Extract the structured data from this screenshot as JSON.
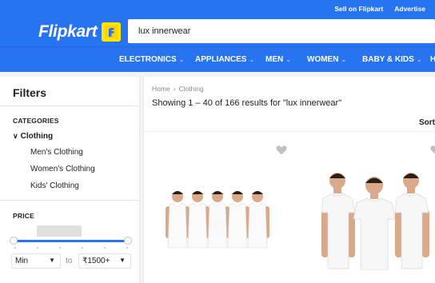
{
  "header": {
    "logo_text": "Flipkart",
    "top_links": [
      "Sell on Flipkart",
      "Advertise"
    ],
    "search": {
      "value": "lux innerwear"
    },
    "brand_color": "#2874f0",
    "badge_color": "#ffe500"
  },
  "nav": {
    "items": [
      "ELECTRONICS",
      "APPLIANCES",
      "MEN",
      "WOMEN",
      "BABY & KIDS",
      "H"
    ]
  },
  "sidebar": {
    "title": "Filters",
    "categories_label": "CATEGORIES",
    "category_parent": "Clothing",
    "category_children": [
      "Men's Clothing",
      "Women's Clothing",
      "Kids' Clothing"
    ],
    "price_label": "PRICE",
    "price_min": "Min",
    "price_to": "to",
    "price_max": "₹1500+"
  },
  "main": {
    "breadcrumb": [
      "Home",
      "Clothing"
    ],
    "results_text": "Showing 1 – 40 of 166 results for \"lux innerwear\"",
    "sort_label": "Sort"
  },
  "products": [
    {
      "name": "vest-pack-white",
      "count_shown": 5
    },
    {
      "name": "tshirt-pack-white",
      "count_shown": 3
    }
  ]
}
